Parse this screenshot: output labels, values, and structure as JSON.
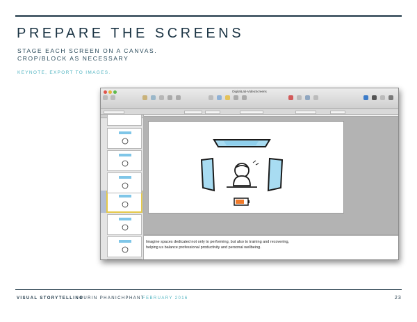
{
  "title": "PREPARE THE SCREENS",
  "subtitle_lines": [
    "STAGE EACH SCREEN ON A CANVAS.",
    "CROP/BLOCK AS NECESSARY"
  ],
  "note": "KEYNOTE, EXPORT TO IMAGES.",
  "screenshot": {
    "window_title": "DigitalLab-VideoScreens",
    "notes_lines": [
      "Imagine spaces dedicated not only to performing, but also to training and recovering,",
      "helping us balance professional productivity and personal wellbeing."
    ]
  },
  "footer": {
    "section": "VISUAL STORYTELLING",
    "author": "PURIN PHANICHPHANT",
    "date": "FEBRUARY 2016",
    "page": "23"
  },
  "colors": {
    "ink": "#1b3444",
    "accent": "#4fb3c0",
    "screen_blue": "#7fc6e8",
    "battery_orange": "#f07a2a"
  }
}
